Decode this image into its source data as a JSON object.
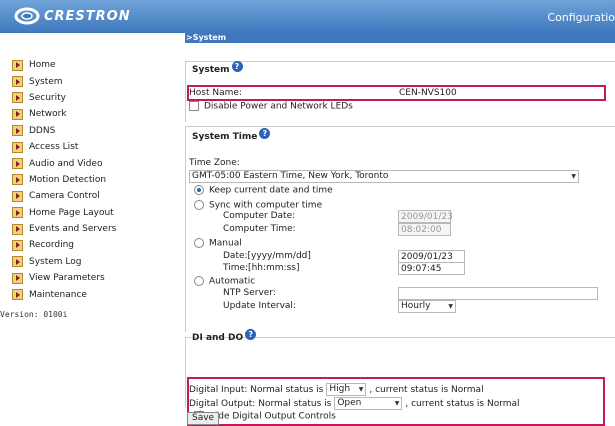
{
  "header": {
    "brand": "CRESTRON",
    "title": "Configuratio"
  },
  "sidebar": {
    "items": [
      {
        "label": "Home"
      },
      {
        "label": "System"
      },
      {
        "label": "Security"
      },
      {
        "label": "Network"
      },
      {
        "label": "DDNS"
      },
      {
        "label": "Access List"
      },
      {
        "label": "Audio and Video"
      },
      {
        "label": "Motion Detection"
      },
      {
        "label": "Camera Control"
      },
      {
        "label": "Home Page Layout"
      },
      {
        "label": "Events and Servers"
      },
      {
        "label": "Recording"
      },
      {
        "label": "System Log"
      },
      {
        "label": "View Parameters"
      },
      {
        "label": "Maintenance"
      }
    ],
    "version": "Version: 0100i"
  },
  "breadcrumb": ">System",
  "system": {
    "heading": "System",
    "host_name_label": "Host Name:",
    "host_name_value": "CEN-NVS100",
    "disable_leds_label": "Disable Power and Network LEDs"
  },
  "system_time": {
    "heading": "System Time",
    "time_zone_label": "Time Zone:",
    "time_zone_value": "GMT-05:00 Eastern Time, New York, Toronto",
    "keep_label": "Keep current date and time",
    "sync_label": "Sync with computer time",
    "computer_date_label": "Computer Date:",
    "computer_date_value": "2009/01/23",
    "computer_time_label": "Computer Time:",
    "computer_time_value": "08:02:00",
    "manual_label": "Manual",
    "date_label": "Date:[yyyy/mm/dd]",
    "date_value": "2009/01/23",
    "time_label": "Time:[hh:mm:ss]",
    "time_value": "09:07:45",
    "automatic_label": "Automatic",
    "ntp_label": "NTP Server:",
    "ntp_value": "",
    "update_label": "Update Interval:",
    "update_value": "Hourly"
  },
  "di_do": {
    "heading": "DI and DO",
    "input_prefix": "Digital Input: Normal status is",
    "input_value": "High",
    "input_suffix": ", current status is Normal",
    "output_prefix": "Digital Output: Normal status is",
    "output_value": "Open",
    "output_suffix": ", current status is Normal",
    "hide_label": "Hide Digital Output Controls"
  },
  "save_label": "Save",
  "colors": {
    "header": "#3f78bd",
    "highlight": "#c8185a"
  }
}
